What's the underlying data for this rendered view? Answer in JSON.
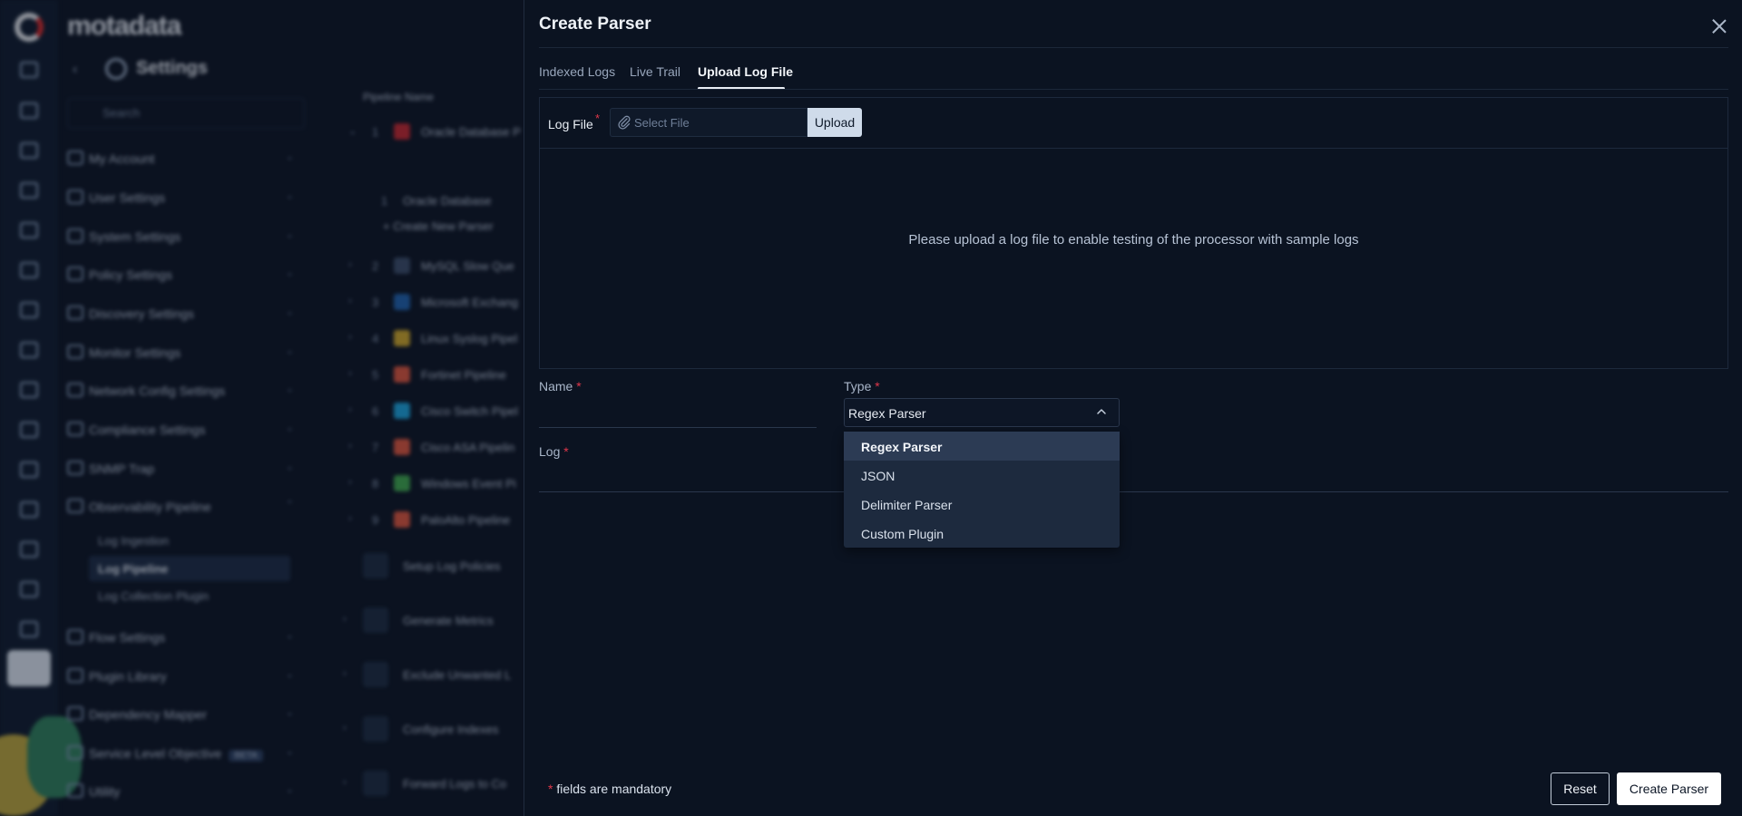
{
  "colors": {
    "required": "#e0374a",
    "drawer_bg": "#0b1321",
    "overlay": "#0b1220"
  },
  "background": {
    "brand": "motadata",
    "section_title": "Settings",
    "search_placeholder": "Search",
    "nav": [
      "My Account",
      "User Settings",
      "System Settings",
      "Policy Settings",
      "Discovery Settings",
      "Monitor Settings",
      "Network Config Settings",
      "Compliance Settings",
      "SNMP Trap",
      "Observability Pipeline"
    ],
    "sub_nav": [
      "Log Ingestion",
      "Log Pipeline",
      "Log Collection Plugin"
    ],
    "nav_bottom": [
      "Flow Settings",
      "Plugin Library",
      "Dependency Mapper",
      "Service Level Objective",
      "Utility"
    ],
    "beta_label": "BETA",
    "pipeline_header": "Pipeline Name",
    "pipelines": [
      {
        "num": "1",
        "name": "Oracle Database P"
      },
      {
        "num": "2",
        "name": "MySQL Slow Que"
      },
      {
        "num": "3",
        "name": "Microsoft Exchang"
      },
      {
        "num": "4",
        "name": "Linux Syslog Pipel"
      },
      {
        "num": "5",
        "name": "Fortinet Pipeline"
      },
      {
        "num": "6",
        "name": "Cisco Switch Pipel"
      },
      {
        "num": "7",
        "name": "Cisco ASA Pipelin"
      },
      {
        "num": "8",
        "name": "Windows Event Pi"
      },
      {
        "num": "9",
        "name": "PaloAlto Pipeline"
      }
    ],
    "child_row": "Oracle Database",
    "child_num": "1",
    "create_new_parser": "+ Create New Parser",
    "steps": [
      "Setup Log Policies",
      "Generate Metrics",
      "Exclude Unwanted L",
      "Configure Indexes",
      "Forward Logs to Co"
    ]
  },
  "drawer": {
    "title": "Create Parser",
    "tabs": [
      {
        "label": "Indexed Logs",
        "active": false
      },
      {
        "label": "Live Trail",
        "active": false
      },
      {
        "label": "Upload Log File",
        "active": true
      }
    ],
    "log_file": {
      "label": "Log File",
      "required_mark": "*",
      "placeholder": "Select File",
      "upload_label": "Upload",
      "icon": "paperclip-icon"
    },
    "empty_message": "Please upload a log file to enable testing of the processor with sample logs",
    "name_field": {
      "label": "Name",
      "required_mark": "*",
      "value": ""
    },
    "type_field": {
      "label": "Type",
      "required_mark": "*",
      "value": "Regex Parser",
      "open": true,
      "options": [
        "Regex Parser",
        "JSON",
        "Delimiter Parser",
        "Custom Plugin"
      ],
      "selected_index": 0
    },
    "log_field": {
      "label": "Log",
      "required_mark": "*",
      "value": ""
    },
    "footer": {
      "required_mark": "*",
      "mandatory_note": " fields are mandatory",
      "reset_label": "Reset",
      "create_label": "Create Parser"
    }
  }
}
